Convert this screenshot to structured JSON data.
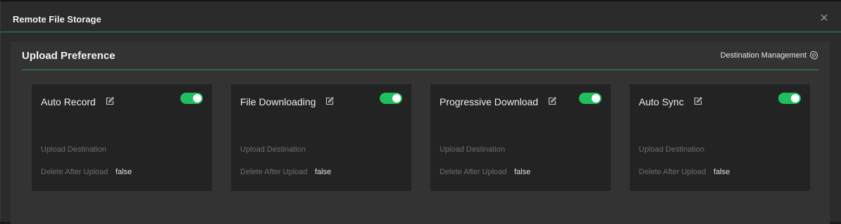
{
  "dialog": {
    "title": "Remote File Storage",
    "close_icon": "close-icon"
  },
  "panel": {
    "title": "Upload Preference",
    "destination_management_label": "Destination Management",
    "destination_management_icon": "gear-icon"
  },
  "colors": {
    "accent": "#1fbf5f",
    "divider": "#2f8f4e"
  },
  "cards": [
    {
      "name": "Auto Record",
      "enabled": true,
      "upload_destination_label": "Upload Destination",
      "upload_destination_value": "",
      "delete_after_upload_label": "Delete After Upload",
      "delete_after_upload_value": "false"
    },
    {
      "name": "File Downloading",
      "enabled": true,
      "upload_destination_label": "Upload Destination",
      "upload_destination_value": "",
      "delete_after_upload_label": "Delete After Upload",
      "delete_after_upload_value": "false"
    },
    {
      "name": "Progressive Download",
      "enabled": true,
      "upload_destination_label": "Upload Destination",
      "upload_destination_value": "",
      "delete_after_upload_label": "Delete After Upload",
      "delete_after_upload_value": "false"
    },
    {
      "name": "Auto Sync",
      "enabled": true,
      "upload_destination_label": "Upload Destination",
      "upload_destination_value": "",
      "delete_after_upload_label": "Delete After Upload",
      "delete_after_upload_value": "false"
    }
  ]
}
